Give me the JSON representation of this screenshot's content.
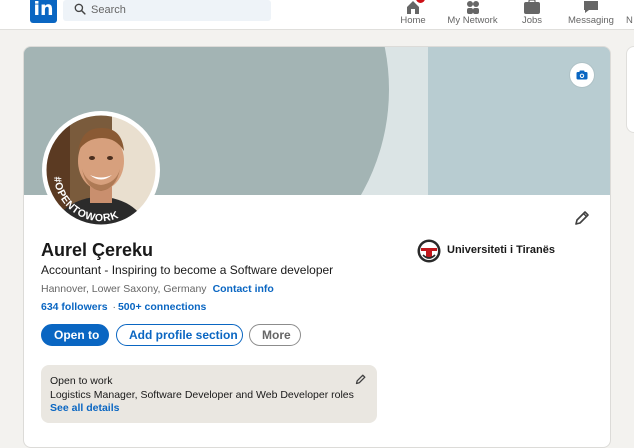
{
  "nav": {
    "logo_text": "in",
    "search_placeholder": "Search",
    "items": [
      {
        "label": "Home",
        "icon": "home-icon",
        "has_badge": true
      },
      {
        "label": "My Network",
        "icon": "network-icon"
      },
      {
        "label": "Jobs",
        "icon": "jobs-icon"
      },
      {
        "label": "Messaging",
        "icon": "messaging-icon"
      },
      {
        "label": "N",
        "icon": "notifications-icon"
      }
    ]
  },
  "cover": {
    "camera_icon": "camera-icon"
  },
  "avatar": {
    "frame_text": "#OPENTOWORK",
    "frame_color": "#3a7a3f"
  },
  "profile": {
    "name": "Aurel Çereku",
    "headline": "Accountant - Inspiring to become a Software developer",
    "location": "Hannover, Lower Saxony, Germany",
    "contact_info_label": "Contact info",
    "followers": "634 followers",
    "separator": "·",
    "connections": "500+ connections"
  },
  "education": {
    "name": "Universiteti i Tiranës"
  },
  "actions": {
    "open_to": "Open to",
    "add_section": "Add profile section",
    "more": "More"
  },
  "open_to_work": {
    "title": "Open to work",
    "roles": "Logistics Manager, Software Developer and Web Developer roles",
    "link": "See all details"
  },
  "colors": {
    "brand": "#0a66c2",
    "page_bg": "#f3f2ef",
    "otw_bg": "#eae7e1"
  }
}
